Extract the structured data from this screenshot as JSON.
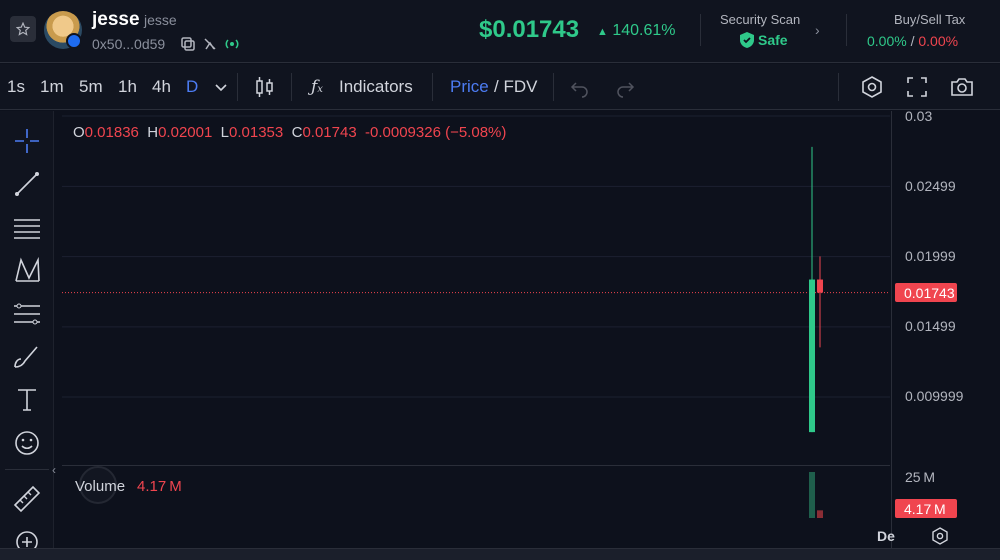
{
  "header": {
    "token_name": "jesse",
    "token_subname": "jesse",
    "address": "0x50...0d59",
    "price": "$0.01743",
    "change": "140.61%",
    "security_title": "Security Scan",
    "security_value": "Safe",
    "tax_title": "Buy/Sell Tax",
    "tax_buy": "0.00%",
    "tax_separator": "/",
    "tax_sell": "0.00%",
    "icons": [
      "star-icon",
      "copy-icon",
      "no-mint-icon",
      "radio-icon",
      "shield-check-icon",
      "chevron-right-icon"
    ]
  },
  "toolbar": {
    "intervals": [
      "1s",
      "1m",
      "5m",
      "1h",
      "4h",
      "D"
    ],
    "active_interval": "D",
    "indicators_label": "Indicators",
    "price_label": "Price",
    "fdv_label": "/ FDV",
    "icons": [
      "chevron-down-icon",
      "candlestick-icon",
      "fx-icon",
      "undo-icon",
      "redo-icon",
      "hexagon-settings-icon",
      "fullscreen-icon",
      "camera-icon"
    ]
  },
  "left_tools": [
    "crosshair-icon",
    "trendline-icon",
    "horizontal-lines-icon",
    "pattern-icon",
    "fib-icon",
    "brush-icon",
    "text-icon",
    "emoji-icon",
    "ruler-icon",
    "zoom-in-icon"
  ],
  "ohlc": {
    "o_label": "O",
    "o": "0.01836",
    "h_label": "H",
    "h": "0.02001",
    "l_label": "L",
    "l": "0.01353",
    "c_label": "C",
    "c": "0.01743",
    "change": "-0.0009326 (−5.08%)"
  },
  "price_axis": {
    "ticks": [
      "0.03",
      "0.02499",
      "0.01999",
      "0.01499",
      "0.009999"
    ],
    "current": "0.01743"
  },
  "volume": {
    "label": "Volume",
    "value": "4.17 M",
    "axis_tick": "25 M",
    "current_tag": "4.17 M"
  },
  "time_axis": {
    "label": "De"
  },
  "colors": {
    "up": "#2fc98a",
    "down": "#f0454f",
    "accent": "#4c7cf3",
    "bg": "#0d111c"
  },
  "chart_data": {
    "type": "candlestick",
    "y_axis_ticks": [
      0.03,
      0.02499,
      0.01999,
      0.01499,
      0.009999
    ],
    "candles": [
      {
        "open": 0.0075,
        "high": 0.0278,
        "low": 0.0075,
        "close": 0.01836,
        "direction": "up"
      },
      {
        "open": 0.01836,
        "high": 0.02001,
        "low": 0.01353,
        "close": 0.01743,
        "direction": "down"
      }
    ],
    "volume": [
      {
        "value": 25000000,
        "direction": "up"
      },
      {
        "value": 4170000,
        "direction": "down"
      }
    ],
    "current_price": 0.01743
  }
}
